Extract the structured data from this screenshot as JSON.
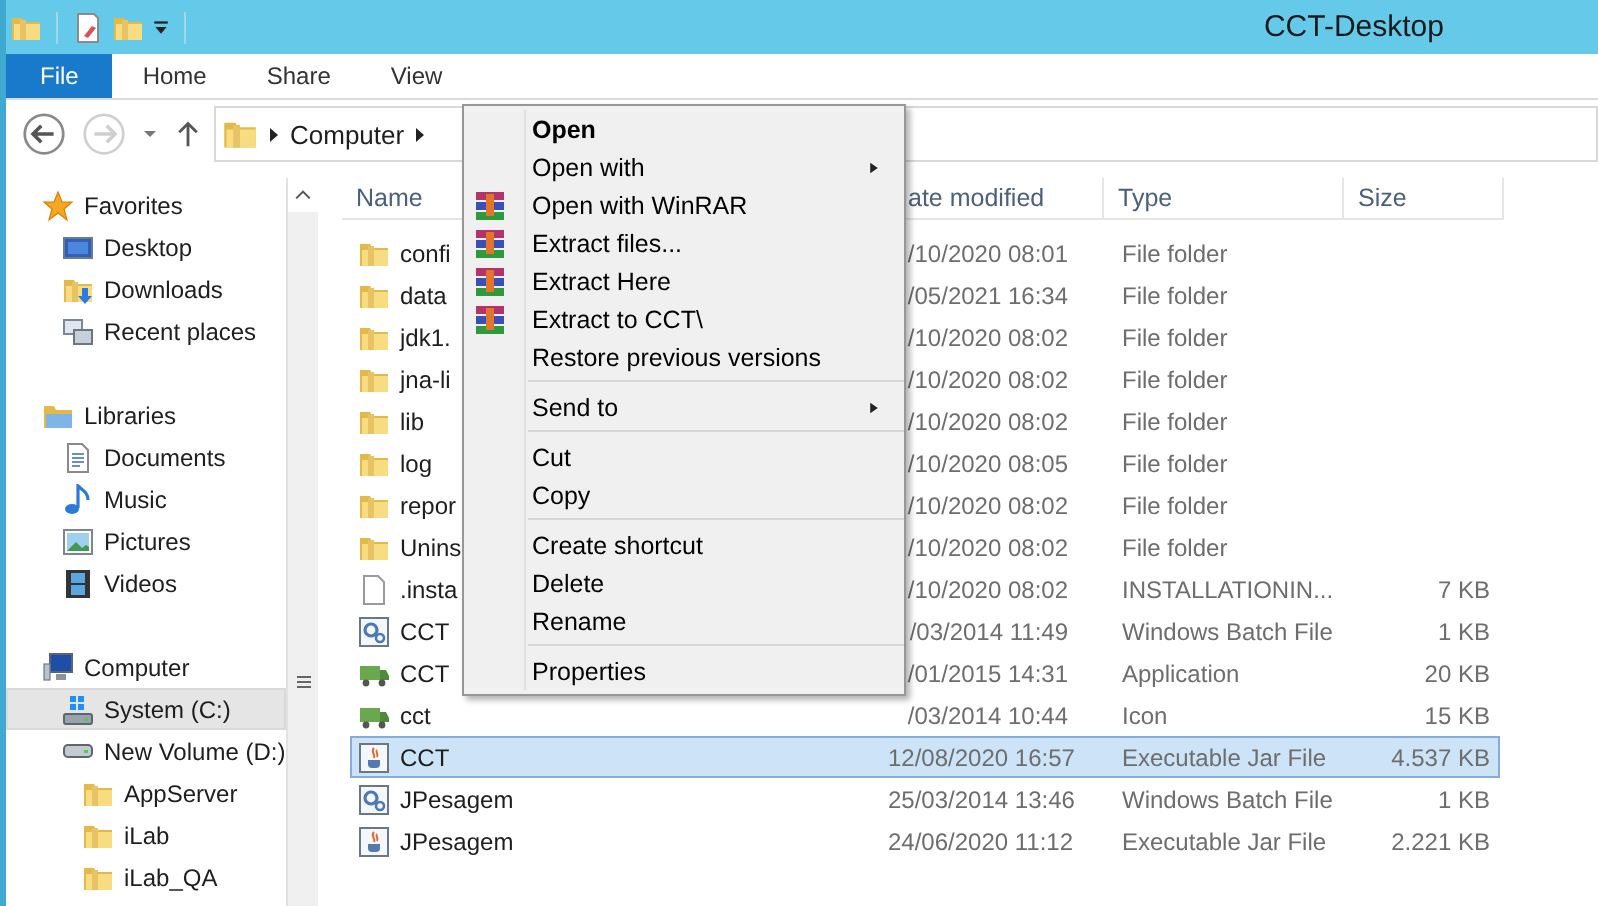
{
  "window": {
    "title": "CCT-Desktop"
  },
  "ribbon_tabs": [
    {
      "label": "File",
      "kind": "file"
    },
    {
      "label": "Home",
      "kind": "tab"
    },
    {
      "label": "Share",
      "kind": "tab"
    },
    {
      "label": "View",
      "kind": "tab"
    }
  ],
  "address_bar": {
    "segments": [
      "Computer"
    ]
  },
  "navigation": [
    {
      "label": "Favorites",
      "kind": "favorites",
      "selected": false,
      "children": [
        {
          "label": "Desktop",
          "kind": "desktop",
          "selected": false
        },
        {
          "label": "Downloads",
          "kind": "downloads",
          "selected": false
        },
        {
          "label": "Recent places",
          "kind": "recent",
          "selected": false
        }
      ]
    },
    {
      "label": "Libraries",
      "kind": "libraries",
      "selected": false,
      "children": [
        {
          "label": "Documents",
          "kind": "documents",
          "selected": false
        },
        {
          "label": "Music",
          "kind": "music",
          "selected": false
        },
        {
          "label": "Pictures",
          "kind": "pictures",
          "selected": false
        },
        {
          "label": "Videos",
          "kind": "videos",
          "selected": false
        }
      ]
    },
    {
      "label": "Computer",
      "kind": "computer",
      "selected": false,
      "children": [
        {
          "label": "System (C:)",
          "kind": "system-drive",
          "selected": true
        },
        {
          "label": "New Volume (D:)",
          "kind": "drive",
          "selected": false,
          "children": [
            {
              "label": "AppServer",
              "kind": "folder",
              "selected": false
            },
            {
              "label": "iLab",
              "kind": "folder",
              "selected": false
            },
            {
              "label": "iLab_QA",
              "kind": "folder",
              "selected": false
            }
          ]
        }
      ]
    }
  ],
  "columns": [
    "Name",
    "ate modified",
    "Type",
    "Size"
  ],
  "files": [
    {
      "name": "confi",
      "kind": "folder",
      "modified": "/10/2020 08:01",
      "type": "File folder",
      "selected": false
    },
    {
      "name": "data",
      "kind": "folder",
      "modified": "/05/2021 16:34",
      "type": "File folder",
      "selected": false
    },
    {
      "name": "jdk1.",
      "kind": "folder",
      "modified": "/10/2020 08:02",
      "type": "File folder",
      "selected": false
    },
    {
      "name": "jna-li",
      "kind": "folder",
      "modified": "/10/2020 08:02",
      "type": "File folder",
      "selected": false
    },
    {
      "name": "lib",
      "kind": "folder",
      "modified": "/10/2020 08:02",
      "type": "File folder",
      "selected": false
    },
    {
      "name": "log",
      "kind": "folder",
      "modified": "/10/2020 08:05",
      "type": "File folder",
      "selected": false
    },
    {
      "name": "repor",
      "kind": "folder",
      "modified": "/10/2020 08:02",
      "type": "File folder",
      "selected": false
    },
    {
      "name": "Unins",
      "kind": "folder",
      "modified": "/10/2020 08:02",
      "type": "File folder",
      "selected": false
    },
    {
      "name": ".insta",
      "kind": "file",
      "modified": "/10/2020 08:02",
      "type": "INSTALLATIONIN...",
      "size": "7 KB",
      "selected": false
    },
    {
      "name": "CCT",
      "kind": "batch",
      "modified": "/03/2014 11:49",
      "type": "Windows Batch File",
      "size": "1 KB",
      "selected": false
    },
    {
      "name": "CCT",
      "kind": "app",
      "modified": "/01/2015 14:31",
      "type": "Application",
      "size": "20 KB",
      "selected": false
    },
    {
      "name": "cct",
      "kind": "app",
      "modified": "/03/2014 10:44",
      "type": "Icon",
      "size": "15 KB",
      "selected": false
    },
    {
      "name": "CCT",
      "kind": "jar",
      "modified": "12/08/2020 16:57",
      "type": "Executable Jar File",
      "size": "4.537 KB",
      "selected": true
    },
    {
      "name": "JPesagem",
      "kind": "batch",
      "modified": "25/03/2014 13:46",
      "type": "Windows Batch File",
      "size": "1 KB",
      "selected": false
    },
    {
      "name": "JPesagem",
      "kind": "jar",
      "modified": "24/06/2020 11:12",
      "type": "Executable Jar File",
      "size": "2.221 KB",
      "selected": false
    }
  ],
  "context_menu": {
    "groups": [
      [
        {
          "label": "Open",
          "kind": "plain",
          "bold": true,
          "submenu": false
        },
        {
          "label": "Open with",
          "kind": "plain",
          "bold": false,
          "submenu": true
        },
        {
          "label": "Open with WinRAR",
          "kind": "winrar",
          "bold": false,
          "submenu": false
        },
        {
          "label": "Extract files...",
          "kind": "winrar",
          "bold": false,
          "submenu": false
        },
        {
          "label": "Extract Here",
          "kind": "winrar",
          "bold": false,
          "submenu": false
        },
        {
          "label": "Extract to CCT\\",
          "kind": "winrar",
          "bold": false,
          "submenu": false
        },
        {
          "label": "Restore previous versions",
          "kind": "plain",
          "bold": false,
          "submenu": false
        }
      ],
      [
        {
          "label": "Send to",
          "kind": "plain",
          "bold": false,
          "submenu": true
        }
      ],
      [
        {
          "label": "Cut",
          "kind": "plain",
          "bold": false,
          "submenu": false
        },
        {
          "label": "Copy",
          "kind": "plain",
          "bold": false,
          "submenu": false
        }
      ],
      [
        {
          "label": "Create shortcut",
          "kind": "plain",
          "bold": false,
          "submenu": false
        },
        {
          "label": "Delete",
          "kind": "plain",
          "bold": false,
          "submenu": false
        },
        {
          "label": "Rename",
          "kind": "plain",
          "bold": false,
          "submenu": false
        }
      ],
      [
        {
          "label": "Properties",
          "kind": "plain",
          "bold": false,
          "submenu": false
        }
      ]
    ]
  }
}
